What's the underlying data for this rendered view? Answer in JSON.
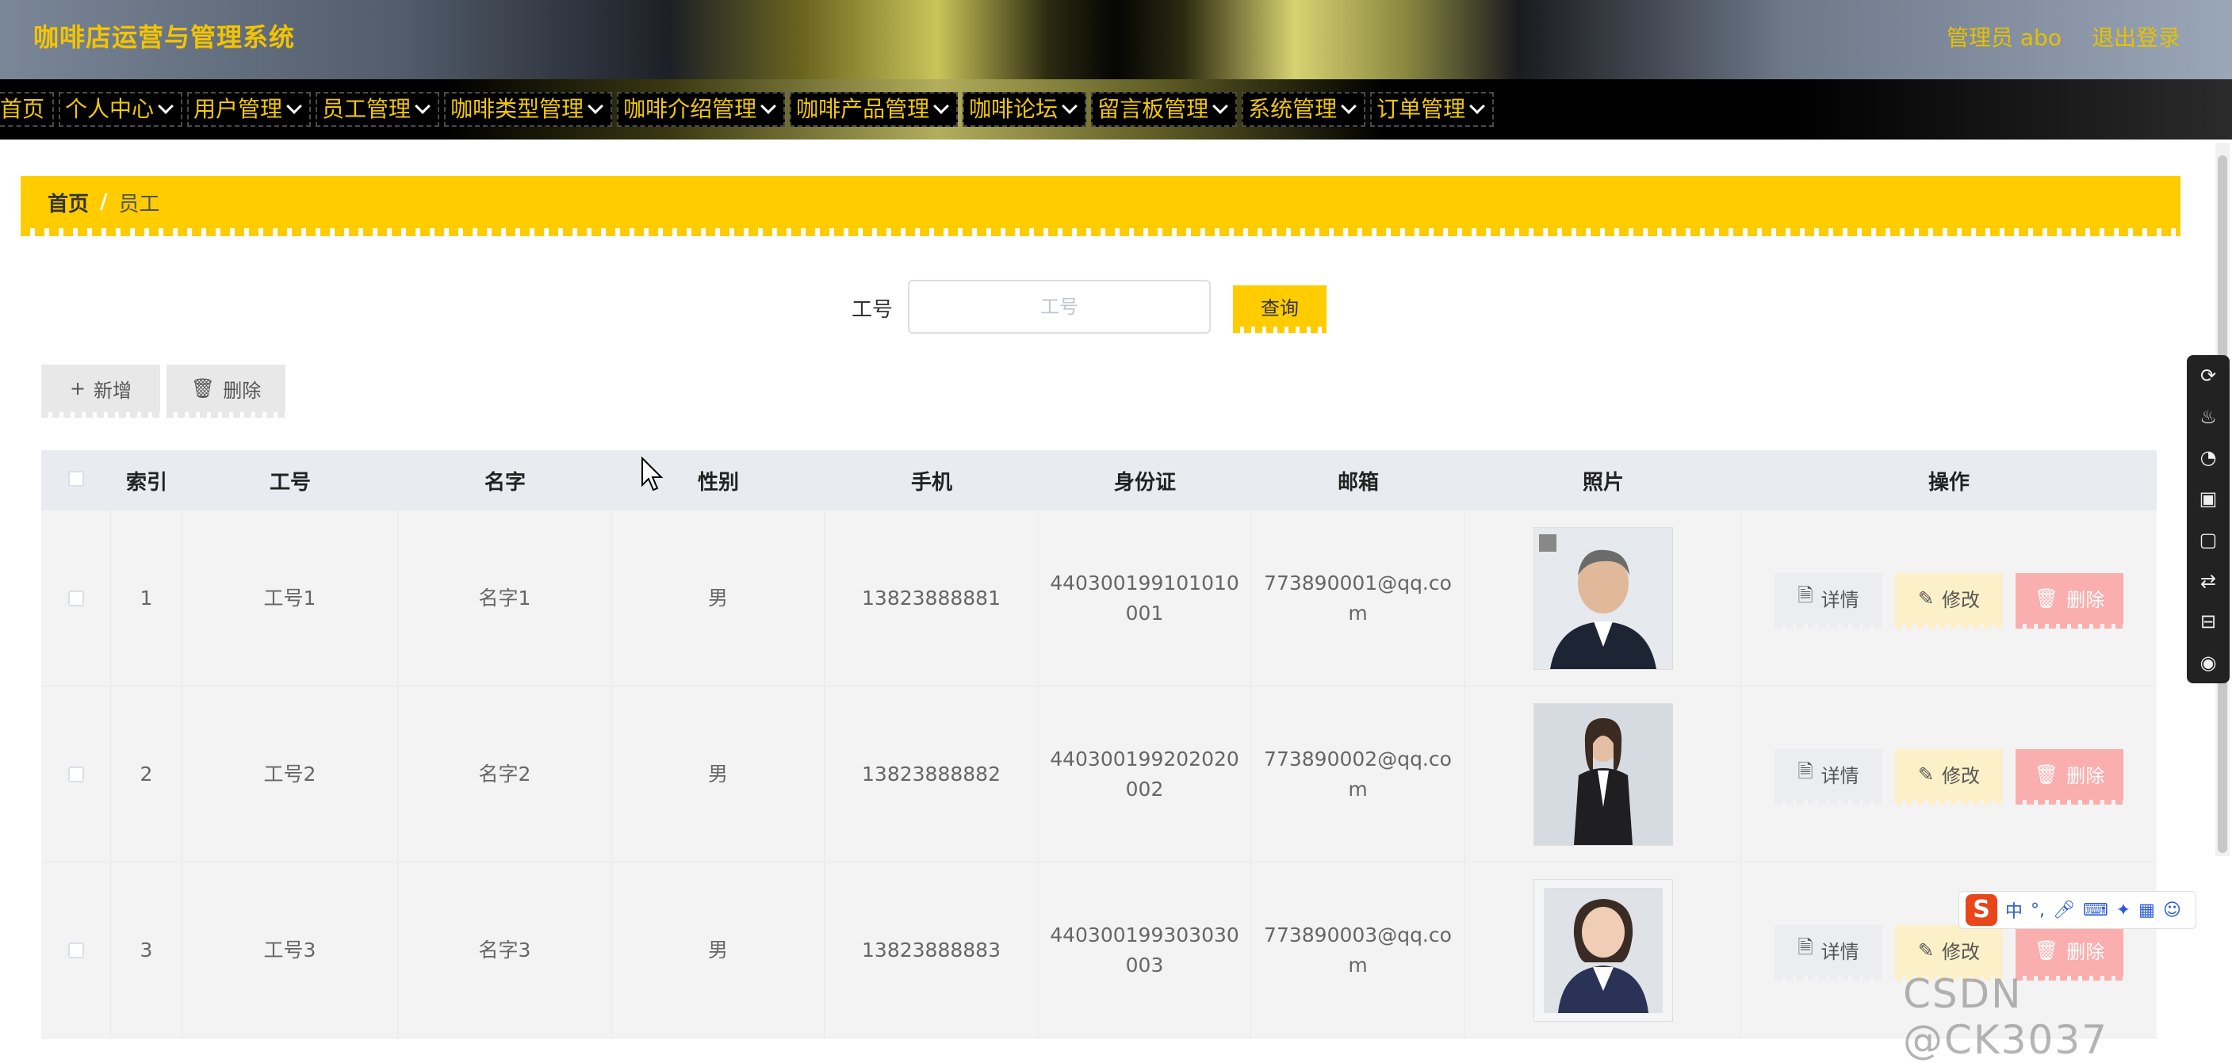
{
  "header": {
    "title": "咖啡店运营与管理系统",
    "admin": "管理员 abo",
    "logout": "退出登录"
  },
  "nav": {
    "items": [
      {
        "label": "首页",
        "dropdown": false
      },
      {
        "label": "个人中心",
        "dropdown": true
      },
      {
        "label": "用户管理",
        "dropdown": true
      },
      {
        "label": "员工管理",
        "dropdown": true
      },
      {
        "label": "咖啡类型管理",
        "dropdown": true
      },
      {
        "label": "咖啡介绍管理",
        "dropdown": true
      },
      {
        "label": "咖啡产品管理",
        "dropdown": true
      },
      {
        "label": "咖啡论坛",
        "dropdown": true
      },
      {
        "label": "留言板管理",
        "dropdown": true
      },
      {
        "label": "系统管理",
        "dropdown": true
      },
      {
        "label": "订单管理",
        "dropdown": true
      }
    ]
  },
  "breadcrumb": {
    "home": "首页",
    "separator": "/",
    "current": "员工"
  },
  "search": {
    "label": "工号",
    "value": "",
    "placeholder": "工号",
    "button": "查询"
  },
  "actions": {
    "add": "新增",
    "delete": "删除"
  },
  "table": {
    "headers": [
      "索引",
      "工号",
      "名字",
      "性别",
      "手机",
      "身份证",
      "邮箱",
      "照片",
      "操作"
    ],
    "rows": [
      {
        "index": "1",
        "no": "工号1",
        "name": "名字1",
        "sex": "男",
        "phone": "13823888881",
        "id": "440300199101010001",
        "email": "773890001@qq.com"
      },
      {
        "index": "2",
        "no": "工号2",
        "name": "名字2",
        "sex": "男",
        "phone": "13823888882",
        "id": "440300199202020002",
        "email": "773890002@qq.com"
      },
      {
        "index": "3",
        "no": "工号3",
        "name": "名字3",
        "sex": "男",
        "phone": "13823888883",
        "id": "440300199303030003",
        "email": "773890003@qq.com"
      }
    ],
    "ops": {
      "detail": "详情",
      "edit": "修改",
      "delete": "删除"
    }
  },
  "ime": {
    "lang": "中"
  },
  "watermark": "CSDN @CK3037",
  "colors": {
    "accent": "#ffcc00",
    "nav_text": "#f0c808",
    "danger": "#fbaeae",
    "edit": "#fbf0c8"
  }
}
